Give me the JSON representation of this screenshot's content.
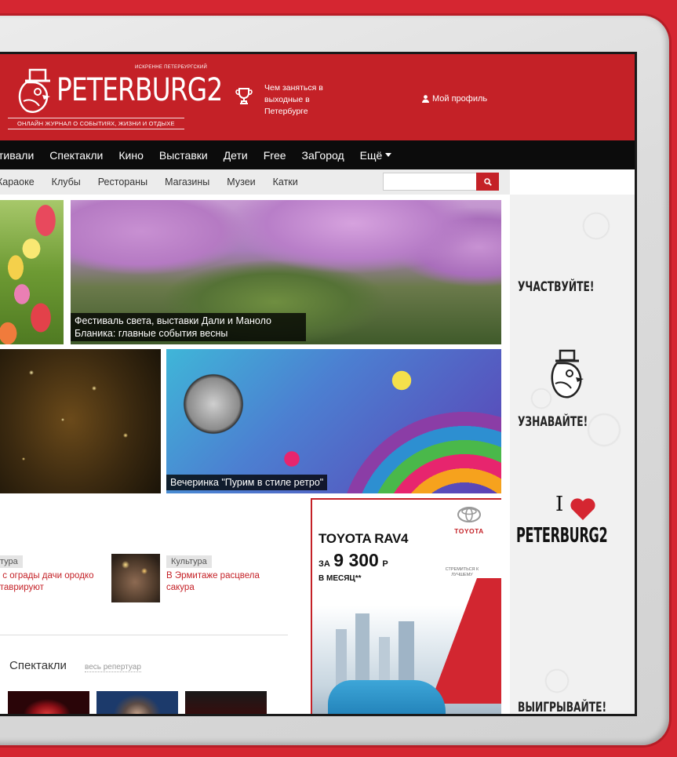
{
  "header": {
    "logo_tag_top": "ИСКРЕННЕ ПЕТЕРБУРГСКИЙ",
    "logo_word": "PETERBURG2",
    "logo_tagline": "ОНЛАЙН ЖУРНАЛ О СОБЫТИЯХ, ЖИЗНИ И ОТДЫХЕ",
    "weekend_link": "Чем заняться в выходные в Петербурге",
    "profile_label": "Мой профиль"
  },
  "nav_main": [
    "тивали",
    "Спектакли",
    "Кино",
    "Выставки",
    "Дети",
    "Free",
    "ЗаГород",
    "Ещё"
  ],
  "nav_sub": [
    "Караоке",
    "Клубы",
    "Рестораны",
    "Магазины",
    "Музеи",
    "Катки"
  ],
  "search": {
    "placeholder": ""
  },
  "tiles": {
    "sakura_caption": "Фестиваль света, выставки Дали и Маноло Бланика: главные события весны",
    "party_caption": "Вечеринка \"Пурим в стиле ретро\""
  },
  "news": [
    {
      "tag": "тура",
      "text": "в с ограды дачи ородко ставрируют"
    },
    {
      "tag": "Культура",
      "text": "В Эрмитаже расцвела сакура"
    }
  ],
  "performances": {
    "title": "Спектакли",
    "link": "весь репертуар"
  },
  "ad": {
    "brand": "TOYOTA",
    "model": "TOYOTA RAV4",
    "price_prefix": "ЗА",
    "price_amount": "9 300",
    "price_currency": "Р",
    "price_period": "В МЕСЯЦ**",
    "slogan": "СТРЕМИТЬСЯ К ЛУЧШЕМУ"
  },
  "sidebar_banner": {
    "participate": "УЧАСТВУЙТЕ!",
    "learn": "УЗНАВАЙТЕ!",
    "i_love": "I",
    "brand": "PETERBURG2",
    "win": "ВЫИГРЫВАЙТЕ!"
  },
  "colors": {
    "brand_red": "#c42127",
    "nav_black": "#0c0c0c",
    "subnav_gray": "#ececec"
  }
}
